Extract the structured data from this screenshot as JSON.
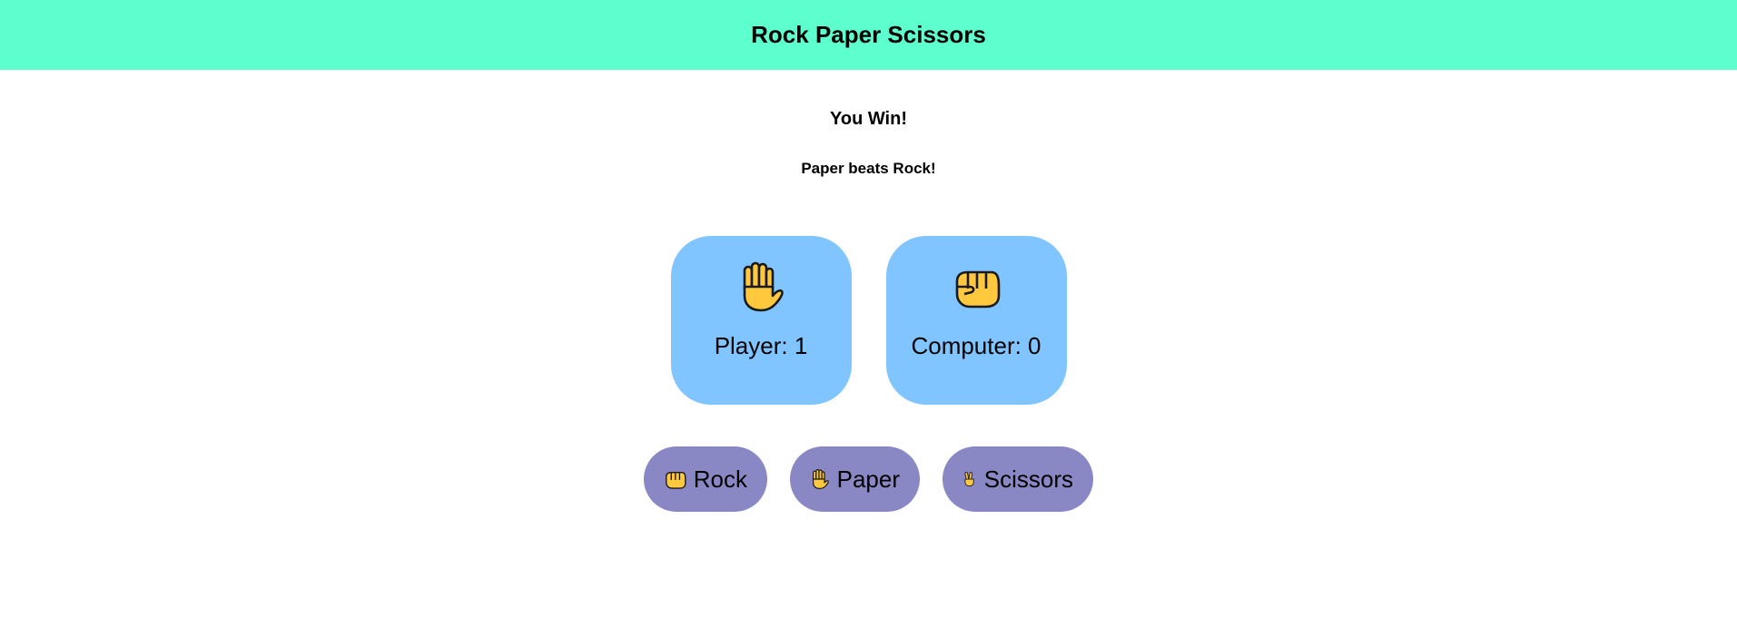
{
  "header": {
    "title": "Rock Paper Scissors"
  },
  "result": {
    "message": "You Win!",
    "detail": "Paper beats Rock!"
  },
  "scores": {
    "player": {
      "label": "Player: 1",
      "icon": "raised-hand-icon"
    },
    "computer": {
      "label": "Computer: 0",
      "icon": "fist-icon"
    }
  },
  "choices": [
    {
      "label": "Rock",
      "icon": "fist-icon"
    },
    {
      "label": "Paper",
      "icon": "raised-hand-icon"
    },
    {
      "label": "Scissors",
      "icon": "victory-hand-icon"
    }
  ],
  "colors": {
    "header_bg": "#5cffcd",
    "card_bg": "#80c5ff",
    "button_bg": "#8a88c4",
    "emoji_yellow": "#ffc83d"
  }
}
